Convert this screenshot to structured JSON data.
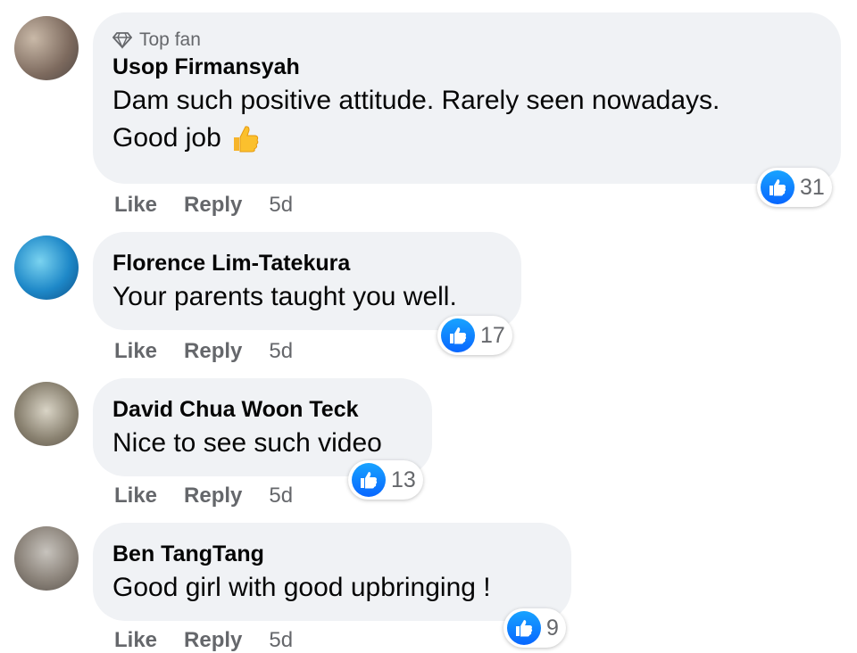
{
  "comments": [
    {
      "badge": "Top fan",
      "name": "Usop Firmansyah",
      "lines": [
        "Dam such positive attitude. Rarely seen nowadays.",
        "Good job"
      ],
      "emoji": "thumbs-up-emoji",
      "actions": {
        "like": "Like",
        "reply": "Reply",
        "time": "5d"
      },
      "reactions": "31"
    },
    {
      "name": "Florence Lim-Tatekura",
      "text": "Your parents taught you well.",
      "actions": {
        "like": "Like",
        "reply": "Reply",
        "time": "5d"
      },
      "reactions": "17"
    },
    {
      "name": "David Chua Woon Teck",
      "text": "Nice to see such video",
      "actions": {
        "like": "Like",
        "reply": "Reply",
        "time": "5d"
      },
      "reactions": "13"
    },
    {
      "name": "Ben TangTang",
      "text": "Good girl with good upbringing !",
      "actions": {
        "like": "Like",
        "reply": "Reply",
        "time": "5d"
      },
      "reactions": "9"
    }
  ],
  "colors": {
    "bubble": "#f0f2f5",
    "secondary_text": "#65676b",
    "like_blue": "#0866ff"
  },
  "icons": [
    "diamond-icon",
    "like-reaction-icon",
    "thumbs-up-emoji"
  ]
}
